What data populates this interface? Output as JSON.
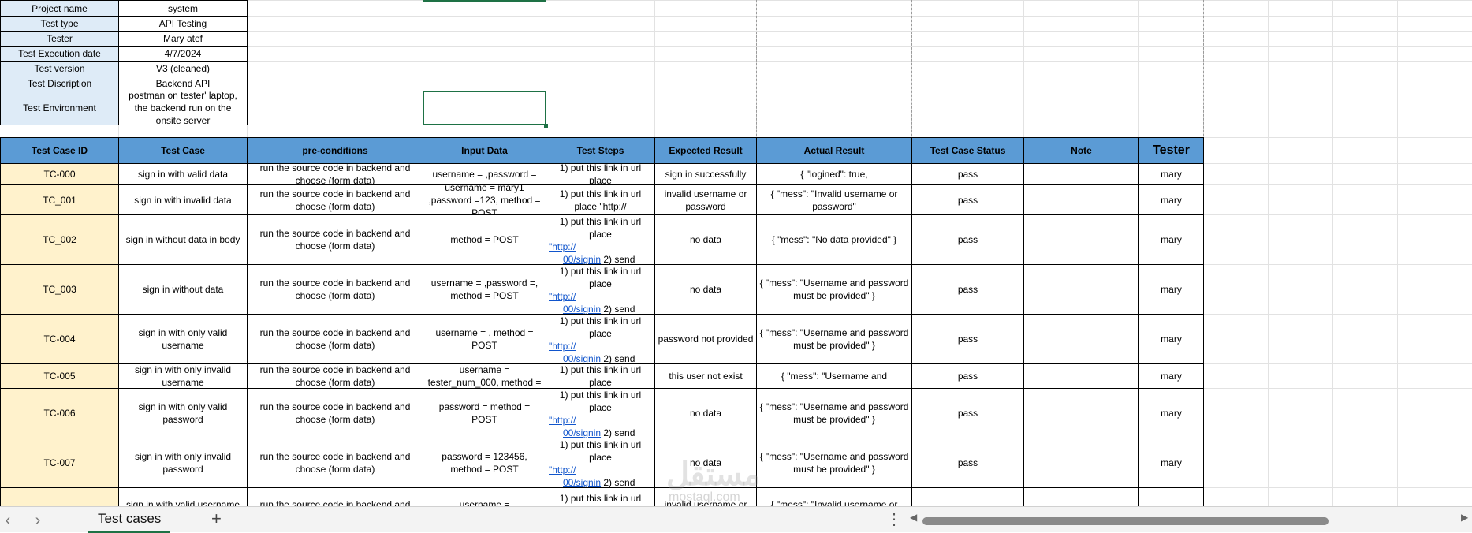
{
  "project_info": [
    {
      "label": "Project name",
      "value": "system"
    },
    {
      "label": "Test type",
      "value": "API Testing"
    },
    {
      "label": "Tester",
      "value": "Mary atef"
    },
    {
      "label": "Test Execution date",
      "value": "4/7/2024"
    },
    {
      "label": "Test version",
      "value": "V3 (cleaned)"
    },
    {
      "label": "Test Discription",
      "value": "Backend API"
    },
    {
      "label": "Test Environment",
      "value": "postman on tester' laptop, the backend run on the onsite server"
    }
  ],
  "table": {
    "headers": [
      "Test Case ID",
      "Test Case",
      "pre-conditions",
      "Input Data",
      "Test Steps",
      "Expected Result",
      "Actual Result",
      "Test Case Status",
      "Note",
      "Tester"
    ],
    "rows": [
      {
        "id": "TC-000",
        "case": "sign in with valid data",
        "pre": "run the source code in backend and choose (form data)",
        "input": "username = ,password =",
        "steps": "1) put this link in url place",
        "expected": "sign in successfully",
        "actual": "{ \"logined\": true,",
        "status": "pass",
        "note": "",
        "tester": "mary"
      },
      {
        "id": "TC_001",
        "case": "sign in with invalid data",
        "pre": "run the source code in backend and choose (form data)",
        "input": "username = mary1 ,password =123, method = POST",
        "steps": "1) put this link in url place \"http://",
        "expected": "invalid username or password",
        "actual": "{ \"mess\": \"Invalid username or password\"",
        "status": "pass",
        "note": "",
        "tester": "mary"
      },
      {
        "id": "TC_002",
        "case": "sign in without data in body",
        "pre": "run the source code in backend and choose (form data)",
        "input": "method = POST",
        "steps": "1) put this link in url place",
        "link": "\"http://",
        "link_end": "00/signin",
        "send": "2) send",
        "expected": "no data",
        "actual": "{ \"mess\": \"No data provided\" }",
        "status": "pass",
        "note": "",
        "tester": "mary"
      },
      {
        "id": "TC_003",
        "case": "sign in without data",
        "pre": "run the source code in backend and choose (form data)",
        "input": "username = ,password =, method = POST",
        "steps": "1) put this link in url place",
        "link": "\"http://",
        "link_end": "00/signin",
        "send": "2) send",
        "expected": "no data",
        "actual": "{ \"mess\": \"Username and password must be provided\" }",
        "status": "pass",
        "note": "",
        "tester": "mary"
      },
      {
        "id": "TC-004",
        "case": "sign in with only valid username",
        "pre": "run the source code in backend and choose (form data)",
        "input": "username = , method = POST",
        "steps": "1) put this link in url place",
        "link": "\"http://",
        "link_end": "00/signin",
        "send": "2) send",
        "expected": "password not provided",
        "actual": "{ \"mess\": \"Username and password must be provided\" }",
        "status": "pass",
        "note": "",
        "tester": "mary"
      },
      {
        "id": "TC-005",
        "case": "sign in with only invalid username",
        "pre": "run the source code in backend and choose (form data)",
        "input": "username = tester_num_000, method =",
        "steps": "1) put this link in url place",
        "expected": "this user not exist",
        "actual": "{ \"mess\": \"Username and",
        "status": "pass",
        "note": "",
        "tester": "mary"
      },
      {
        "id": "TC-006",
        "case": "sign in with only valid password",
        "pre": "run the source code in backend and choose (form data)",
        "input": "password = method = POST",
        "steps": "1) put this link in url place",
        "link": "\"http://",
        "link_end": "00/signin",
        "send": "2) send",
        "expected": "no data",
        "actual": "{ \"mess\": \"Username and password must be provided\" }",
        "status": "pass",
        "note": "",
        "tester": "mary"
      },
      {
        "id": "TC-007",
        "case": "sign in with only invalid password",
        "pre": "run the source code in backend and choose (form data)",
        "input": "password = 123456, method = POST",
        "steps": "1) put this link in url place",
        "link": "\"http://",
        "link_end": "00/signin",
        "send": "2) send",
        "expected": "no data",
        "actual": "{ \"mess\": \"Username and password must be provided\" }",
        "status": "pass",
        "note": "",
        "tester": "mary"
      },
      {
        "id": "",
        "case": "sign in with valid username",
        "pre": "run the source code in backend and",
        "input": "username =",
        "steps": "1) put this link in url place",
        "expected": "invalid username or",
        "actual": "{ \"mess\": \"Invalid username or",
        "status": "",
        "note": "",
        "tester": ""
      }
    ]
  },
  "watermark": {
    "arabic": "مستقل",
    "latin": "mostaql.com"
  },
  "sheet_tab": {
    "name": "Test cases",
    "add_symbol": "+"
  },
  "nav": {
    "prev": "‹",
    "next": "›",
    "more": "⋮",
    "scroll_left": "◀",
    "scroll_right": "▶"
  }
}
